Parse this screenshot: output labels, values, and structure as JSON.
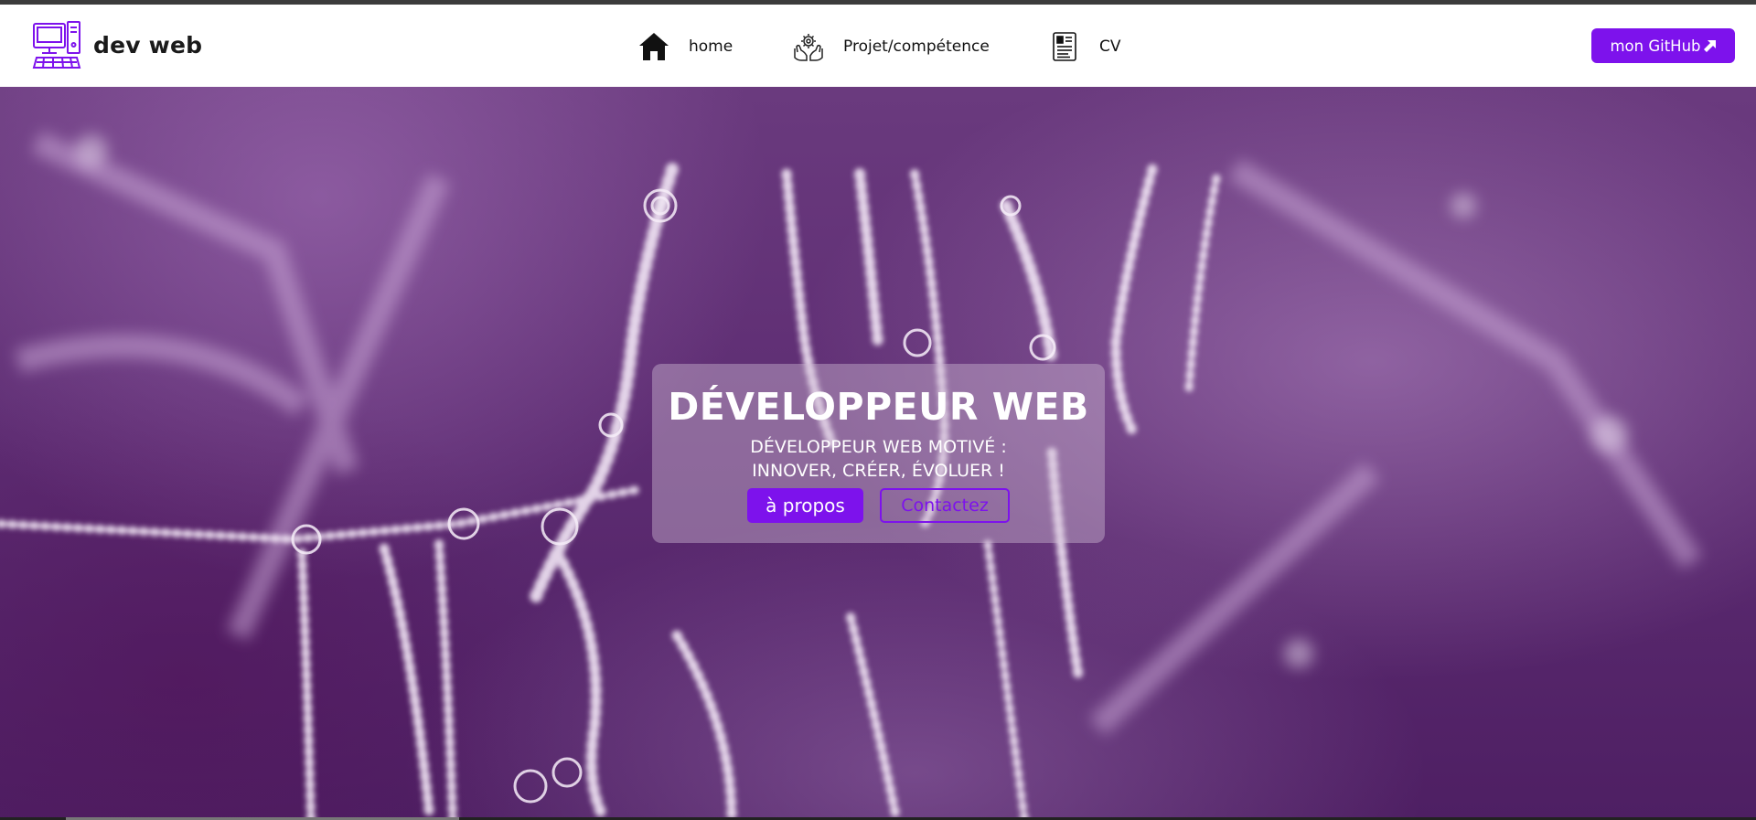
{
  "colors": {
    "accent": "#7d12ec",
    "navbar_bg": "#ffffff",
    "hero_tint": "#5d2c72"
  },
  "brand": {
    "name": "dev web",
    "logo_icon": "computer-icon"
  },
  "nav": {
    "items": [
      {
        "label": "home",
        "icon": "home-icon"
      },
      {
        "label": "Projet/compétence",
        "icon": "hand-gear-icon"
      },
      {
        "label": "CV",
        "icon": "resume-icon"
      }
    ]
  },
  "github": {
    "label": "mon GitHub",
    "icon": "arrow-up-right-icon"
  },
  "hero": {
    "title": "DÉVELOPPEUR WEB",
    "subtitle_line1": "DÉVELOPPEUR WEB MOTIVÉ :",
    "subtitle_line2": "INNOVER, CRÉER, ÉVOLUER !",
    "about_button": "à propos",
    "contact_button": "Contactez"
  }
}
